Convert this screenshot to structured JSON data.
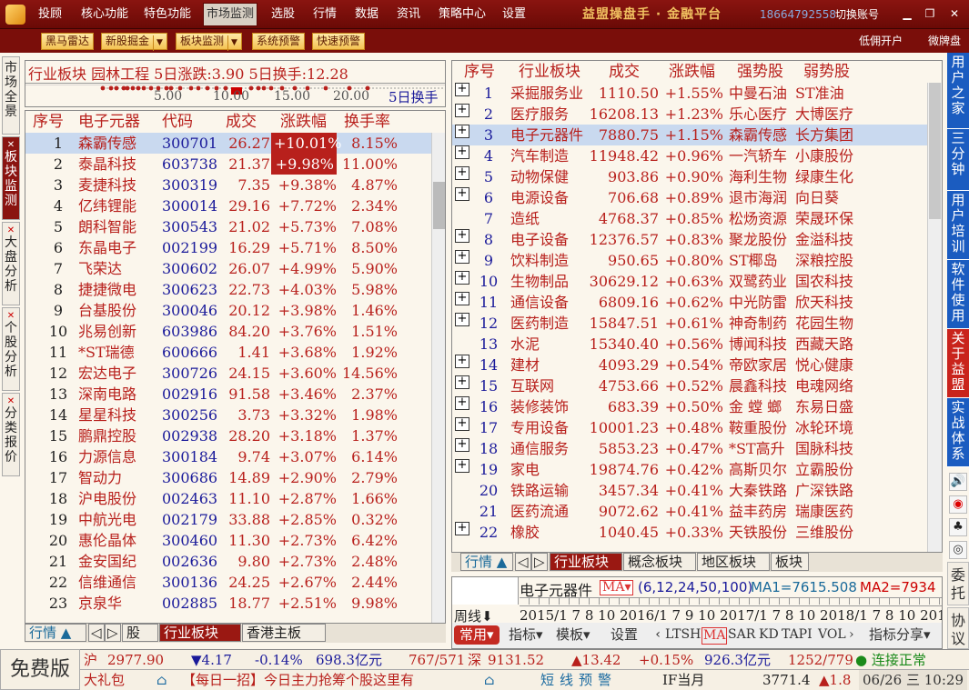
{
  "menu": [
    "投顾",
    "核心功能",
    "特色功能",
    "市场监测",
    "选股",
    "行情",
    "数据",
    "资讯",
    "策略中心",
    "设置"
  ],
  "menu_active": "市场监测",
  "brand": "益盟操盘手 · 金融平台",
  "phone": "18664792558",
  "switch_account": "切换账号",
  "toolbar": {
    "buttons": [
      "黑马雷达",
      "新股掘金",
      "板块监测",
      "系统预警",
      "快速预警"
    ],
    "dropdown_flags": [
      false,
      true,
      true,
      false,
      false
    ],
    "right_links": [
      "低佣开户",
      "微牌盘"
    ]
  },
  "left_tabs": [
    {
      "label": "市场全景",
      "closable": false,
      "selected": false
    },
    {
      "label": "板块监测",
      "closable": true,
      "selected": true
    },
    {
      "label": "大盘分析",
      "closable": true,
      "selected": false
    },
    {
      "label": "个股分析",
      "closable": true,
      "selected": false
    },
    {
      "label": "分类报价",
      "closable": true,
      "selected": false
    }
  ],
  "sector_info": {
    "line": "行业板块 园林工程 5日涨跌:3.90 5日换手:12.28",
    "scale_ticks": [
      "5.00",
      "10.00",
      "15.00",
      "20.00"
    ],
    "scale_unit": "5日换手"
  },
  "stock_table": {
    "headers": [
      "序号",
      "电子元器",
      "代码",
      "成交",
      "涨跌幅",
      "换手率"
    ],
    "rows": [
      [
        "1",
        "森霸传感",
        "300701",
        "26.27",
        "+10.01%",
        "8.15%"
      ],
      [
        "2",
        "泰晶科技",
        "603738",
        "21.37",
        "+9.98%",
        "11.00%"
      ],
      [
        "3",
        "麦捷科技",
        "300319",
        "7.35",
        "+9.38%",
        "4.87%"
      ],
      [
        "4",
        "亿纬锂能",
        "300014",
        "29.16",
        "+7.72%",
        "2.34%"
      ],
      [
        "5",
        "朗科智能",
        "300543",
        "21.02",
        "+5.73%",
        "7.08%"
      ],
      [
        "6",
        "东晶电子",
        "002199",
        "16.29",
        "+5.71%",
        "8.50%"
      ],
      [
        "7",
        "飞荣达",
        "300602",
        "26.07",
        "+4.99%",
        "5.90%"
      ],
      [
        "8",
        "捷捷微电",
        "300623",
        "22.73",
        "+4.03%",
        "5.98%"
      ],
      [
        "9",
        "台基股份",
        "300046",
        "20.12",
        "+3.98%",
        "1.46%"
      ],
      [
        "10",
        "兆易创新",
        "603986",
        "84.20",
        "+3.76%",
        "1.51%"
      ],
      [
        "11",
        "*ST瑞德",
        "600666",
        "1.41",
        "+3.68%",
        "1.92%"
      ],
      [
        "12",
        "宏达电子",
        "300726",
        "24.15",
        "+3.60%",
        "14.56%"
      ],
      [
        "13",
        "深南电路",
        "002916",
        "91.58",
        "+3.46%",
        "2.37%"
      ],
      [
        "14",
        "星星科技",
        "300256",
        "3.73",
        "+3.32%",
        "1.98%"
      ],
      [
        "15",
        "鹏鼎控股",
        "002938",
        "28.20",
        "+3.18%",
        "1.37%"
      ],
      [
        "16",
        "力源信息",
        "300184",
        "9.74",
        "+3.07%",
        "6.14%"
      ],
      [
        "17",
        "智动力",
        "300686",
        "14.89",
        "+2.90%",
        "2.79%"
      ],
      [
        "18",
        "沪电股份",
        "002463",
        "11.10",
        "+2.87%",
        "1.66%"
      ],
      [
        "19",
        "中航光电",
        "002179",
        "33.88",
        "+2.85%",
        "0.32%"
      ],
      [
        "20",
        "惠伦晶体",
        "300460",
        "11.30",
        "+2.73%",
        "6.42%"
      ],
      [
        "21",
        "金安国纪",
        "002636",
        "9.80",
        "+2.73%",
        "2.48%"
      ],
      [
        "22",
        "信维通信",
        "300136",
        "24.25",
        "+2.67%",
        "2.44%"
      ],
      [
        "23",
        "京泉华",
        "002885",
        "18.77",
        "+2.51%",
        "9.98%"
      ]
    ],
    "boxed_rows": [
      0,
      1
    ],
    "selected_row": 0,
    "bottom_tabs": [
      "行情",
      "股",
      "行业板块",
      "香港主板"
    ]
  },
  "sector_table": {
    "headers": [
      "序号",
      "行业板块",
      "成交",
      "涨跌幅",
      "强势股",
      "弱势股"
    ],
    "rows": [
      [
        "1",
        "采掘服务业",
        "1110.50",
        "+1.55%",
        "中曼石油",
        "ST准油"
      ],
      [
        "2",
        "医疗服务",
        "16208.13",
        "+1.23%",
        "乐心医疗",
        "大博医疗"
      ],
      [
        "3",
        "电子元器件",
        "7880.75",
        "+1.15%",
        "森霸传感",
        "长方集团"
      ],
      [
        "4",
        "汽车制造",
        "11948.42",
        "+0.96%",
        "一汽轿车",
        "小康股份"
      ],
      [
        "5",
        "动物保健",
        "903.86",
        "+0.90%",
        "海利生物",
        "绿康生化"
      ],
      [
        "6",
        "电源设备",
        "706.68",
        "+0.89%",
        "退市海润",
        "向日葵"
      ],
      [
        "7",
        "造纸",
        "4768.37",
        "+0.85%",
        "松炀资源",
        "荣晟环保"
      ],
      [
        "8",
        "电子设备",
        "12376.57",
        "+0.83%",
        "聚龙股份",
        "金溢科技"
      ],
      [
        "9",
        "饮料制造",
        "950.65",
        "+0.80%",
        "ST椰岛",
        "深粮控股"
      ],
      [
        "10",
        "生物制品",
        "30629.12",
        "+0.63%",
        "双鹭药业",
        "国农科技"
      ],
      [
        "11",
        "通信设备",
        "6809.16",
        "+0.62%",
        "中光防雷",
        "欣天科技"
      ],
      [
        "12",
        "医药制造",
        "15847.51",
        "+0.61%",
        "神奇制药",
        "花园生物"
      ],
      [
        "13",
        "水泥",
        "15340.40",
        "+0.56%",
        "博闻科技",
        "西藏天路"
      ],
      [
        "14",
        "建材",
        "4093.29",
        "+0.54%",
        "帝欧家居",
        "悦心健康"
      ],
      [
        "15",
        "互联网",
        "4753.66",
        "+0.52%",
        "晨鑫科技",
        "电魂网络"
      ],
      [
        "16",
        "装修装饰",
        "683.39",
        "+0.50%",
        "金 螳 螂",
        "东易日盛"
      ],
      [
        "17",
        "专用设备",
        "10001.23",
        "+0.48%",
        "鞍重股份",
        "冰轮环境"
      ],
      [
        "18",
        "通信服务",
        "5853.23",
        "+0.47%",
        "*ST高升",
        "国脉科技"
      ],
      [
        "19",
        "家电",
        "19874.76",
        "+0.42%",
        "高斯贝尔",
        "立霸股份"
      ],
      [
        "20",
        "铁路运输",
        "3457.34",
        "+0.41%",
        "大秦铁路",
        "广深铁路"
      ],
      [
        "21",
        "医药流通",
        "9072.62",
        "+0.41%",
        "益丰药房",
        "瑞康医药"
      ],
      [
        "22",
        "橡胶",
        "1040.45",
        "+0.33%",
        "天铁股份",
        "三维股份"
      ]
    ],
    "plus_rows": [
      0,
      1,
      2,
      3,
      4,
      5,
      7,
      8,
      9,
      10,
      11,
      13,
      14,
      15,
      16,
      17,
      18,
      21
    ],
    "selected_row": 2,
    "bottom_tabs": [
      "行情",
      "行业板块",
      "概念板块",
      "地区板块",
      "板块"
    ]
  },
  "chart_panel": {
    "name": "电子元器件",
    "ma_label": "MA",
    "ma_params": "(6,12,24,50,100)",
    "ma1": "MA1=7615.508",
    "ma2": "MA2=7934",
    "period": "周线",
    "timeline": "2015/1 7 8 10 2016/1 7 9 10 2017/1 7 8 10 2018/1 7 8 10 2019/1",
    "toolbar_row1": [
      "常用",
      "指标",
      "模板",
      "设置",
      "LTSH",
      "MA",
      "SAR",
      "KD",
      "TAPI",
      "VOL",
      "指标分享"
    ]
  },
  "right_tabs": [
    "用户之家",
    "三分钟",
    "用户培训",
    "软件使用",
    "关于益盟",
    "实战体系"
  ],
  "right_icons": [
    "speaker-icon",
    "weibo-icon",
    "qq-icon",
    "wechat-icon"
  ],
  "right_bottom": [
    "委托",
    "协议"
  ],
  "status": {
    "edition": "免费版",
    "sh_label": "沪",
    "sh_index": "2977.90",
    "sh_change": "▼4.17",
    "sh_pct": "-0.14%",
    "sh_amount": "698.3亿元",
    "sh_updown": "767/571",
    "sz_label": "深",
    "sz_index": "9131.52",
    "sz_change": "▲13.42",
    "sz_pct": "+0.15%",
    "sz_amount": "926.3亿元",
    "sz_updown": "1252/779",
    "connection": "连接正常",
    "gift": "大礼包",
    "tip": "【每日一招】今日主力抢筹个股这里有",
    "alert": "短线预警",
    "future_label": "IF当月",
    "future_val": "3771.4",
    "future_chg": "▲1.8",
    "datetime": "06/26 三  10:29"
  },
  "colors": {
    "brand_red": "#8a1410",
    "up": "#b8201c",
    "down": "#1a1a9a",
    "select": "#c9d9ef",
    "side_blue": "#1b5cc0"
  }
}
